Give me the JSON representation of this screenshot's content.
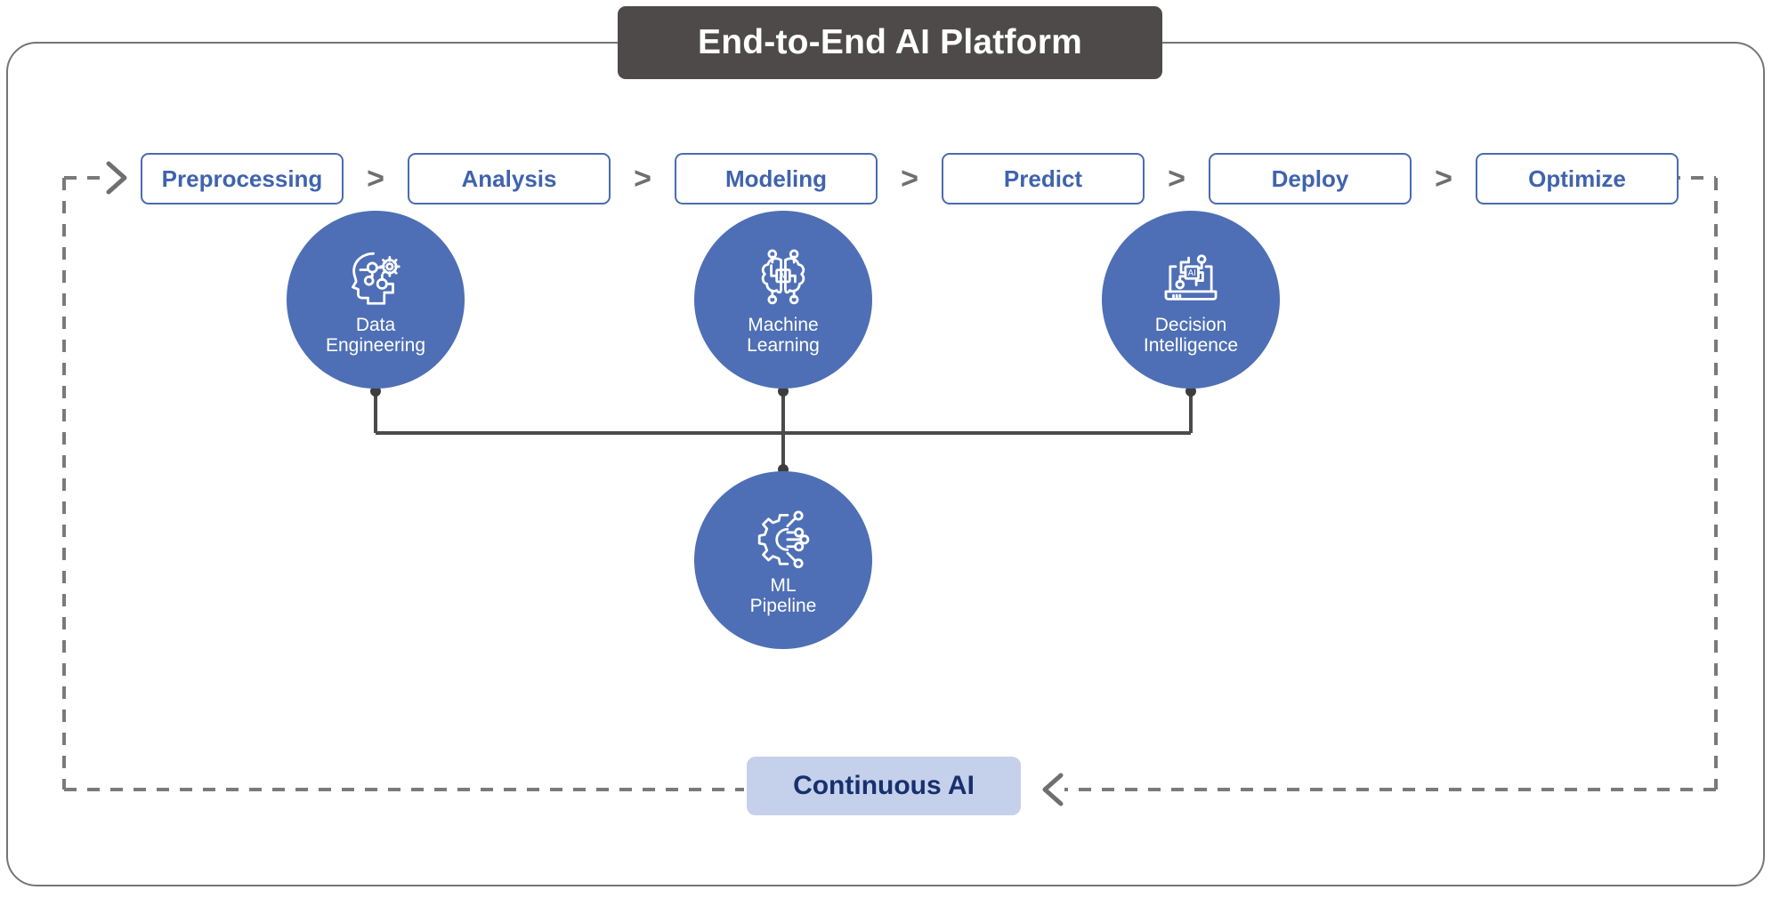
{
  "diagram": {
    "title": "End-to-End AI Platform",
    "colors": {
      "title_bar_bg": "#4d4a49",
      "title_bar_text": "#ffffff",
      "frame_border": "#757575",
      "stage_border": "#4a6bb0",
      "stage_text": "#3f63ad",
      "circle_fill": "#4e6fb5",
      "circle_text": "#ffffff",
      "loop_dash": "#7a7a7a",
      "connector": "#4a4a4a",
      "continuous_bg": "#c5d0ea",
      "continuous_text": "#17306e"
    }
  },
  "pipeline": {
    "separator": ">",
    "stages": [
      {
        "label": "Preprocessing"
      },
      {
        "label": "Analysis"
      },
      {
        "label": "Modeling"
      },
      {
        "label": "Predict"
      },
      {
        "label": "Deploy"
      },
      {
        "label": "Optimize"
      }
    ]
  },
  "nodes": [
    {
      "label": "Data\nEngineering",
      "icon": "head-gears-icon"
    },
    {
      "label": "Machine\nLearning",
      "icon": "ai-brain-chip-icon"
    },
    {
      "label": "Decision\nIntelligence",
      "icon": "laptop-ai-circuit-icon"
    },
    {
      "label": "ML\nPipeline",
      "icon": "gear-circuit-icon"
    }
  ],
  "feedback": {
    "chip_label": "Continuous AI",
    "entry_arrow": ">",
    "return_arrow": "<"
  }
}
